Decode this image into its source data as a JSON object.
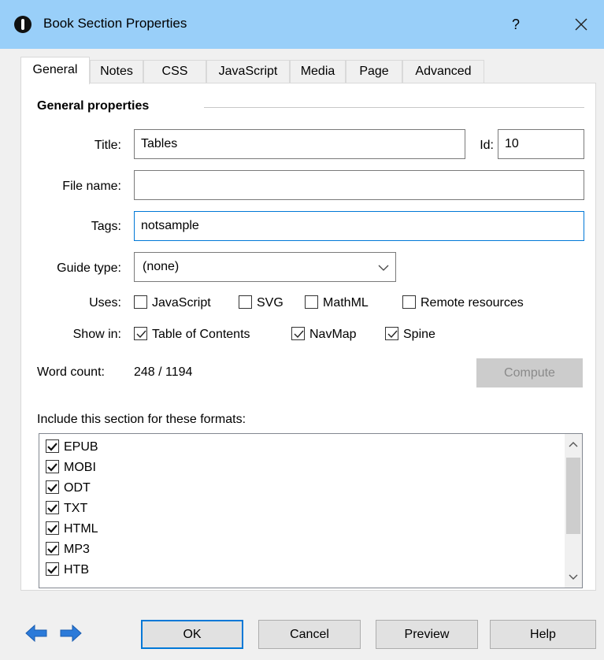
{
  "window": {
    "title": "Book Section Properties",
    "help_label": "?"
  },
  "tabs": [
    "General",
    "Notes",
    "CSS",
    "JavaScript",
    "Media",
    "Page",
    "Advanced"
  ],
  "general": {
    "group_title": "General properties",
    "title_label": "Title:",
    "title_value": "Tables",
    "id_label": "Id:",
    "id_value": "10",
    "filename_label": "File name:",
    "filename_value": "",
    "tags_label": "Tags:",
    "tags_value": "notsample",
    "guide_label": "Guide type:",
    "guide_value": "(none)",
    "uses_label": "Uses:",
    "uses_options": [
      {
        "label": "JavaScript",
        "checked": false
      },
      {
        "label": "SVG",
        "checked": false
      },
      {
        "label": "MathML",
        "checked": false
      },
      {
        "label": "Remote resources",
        "checked": false
      }
    ],
    "showin_label": "Show in:",
    "showin_options": [
      {
        "label": "Table of Contents",
        "checked": true
      },
      {
        "label": "NavMap",
        "checked": true
      },
      {
        "label": "Spine",
        "checked": true
      }
    ],
    "wordcount_label": "Word count:",
    "wordcount_value": "248 / 1194",
    "compute_label": "Compute",
    "formats_label": "Include this section for these formats:",
    "formats": [
      {
        "label": "EPUB",
        "checked": true
      },
      {
        "label": "MOBI",
        "checked": true
      },
      {
        "label": "ODT",
        "checked": true
      },
      {
        "label": "TXT",
        "checked": true
      },
      {
        "label": "HTML",
        "checked": true
      },
      {
        "label": "MP3",
        "checked": true
      },
      {
        "label": "HTB",
        "checked": true
      }
    ]
  },
  "buttons": {
    "ok": "OK",
    "cancel": "Cancel",
    "preview": "Preview",
    "help": "Help"
  },
  "colors": {
    "titlebar": "#99cff9",
    "focus": "#0078d7",
    "nav_arrow": "#2b7ad9"
  }
}
